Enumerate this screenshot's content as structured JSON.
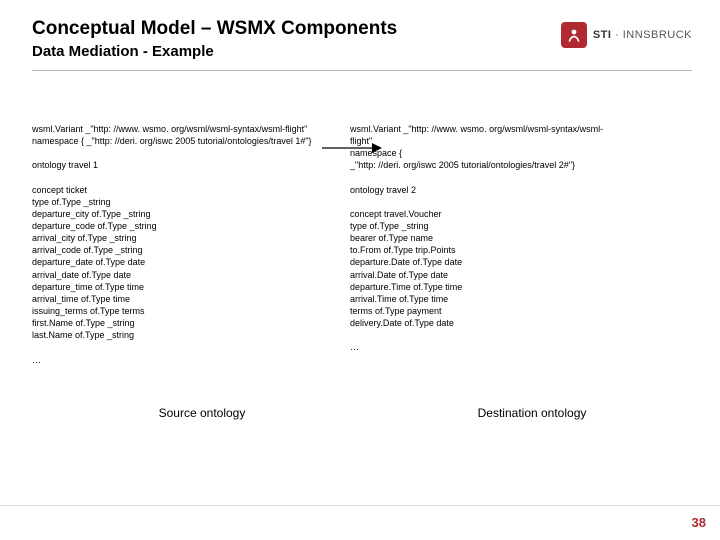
{
  "header": {
    "title": "Conceptual Model – WSMX Components",
    "subtitle": "Data Mediation - Example",
    "logo": {
      "name_bold": "STI",
      "name_rest": " · INNSBRUCK"
    }
  },
  "left": {
    "variant": "wsml.Variant _\"http: //www. wsmo. org/wsml/wsml-syntax/wsml-flight\"",
    "namespace": "namespace { _\"http: //deri. org/iswc 2005 tutorial/ontologies/travel 1#\"}",
    "ontology": "ontology travel 1",
    "concept_head": "concept ticket",
    "concept_body": "        type of.Type _string\n        departure_city of.Type _string\n        departure_code of.Type _string\n        arrival_city of.Type _string\n        arrival_code of.Type _string\n        departure_date of.Type date\n        arrival_date of.Type date\n        departure_time of.Type time\n        arrival_time of.Type time\n        issuing_terms of.Type terms\n        first.Name of.Type _string\n        last.Name of.Type _string",
    "ellipsis": "…"
  },
  "right": {
    "variant": "wsml.Variant _\"http: //www. wsmo. org/wsml/wsml-syntax/wsml-\n     flight\"",
    "namespace": "namespace {\n     _\"http: //deri. org/iswc 2005 tutorial/ontologies/travel 2#\"}",
    "ontology": "ontology travel 2",
    "concept_head": "concept travel.Voucher",
    "concept_body": "        type of.Type _string\n        bearer of.Type name\n        to.From of.Type trip.Points\n        departure.Date of.Type date\n        arrival.Date of.Type date\n        departure.Time of.Type time\n        arrival.Time of.Type time\n        terms of.Type payment\n        delivery.Date of.Type date",
    "ellipsis": "…"
  },
  "labels": {
    "source": "Source ontology",
    "dest": "Destination ontology"
  },
  "page_number": "38"
}
